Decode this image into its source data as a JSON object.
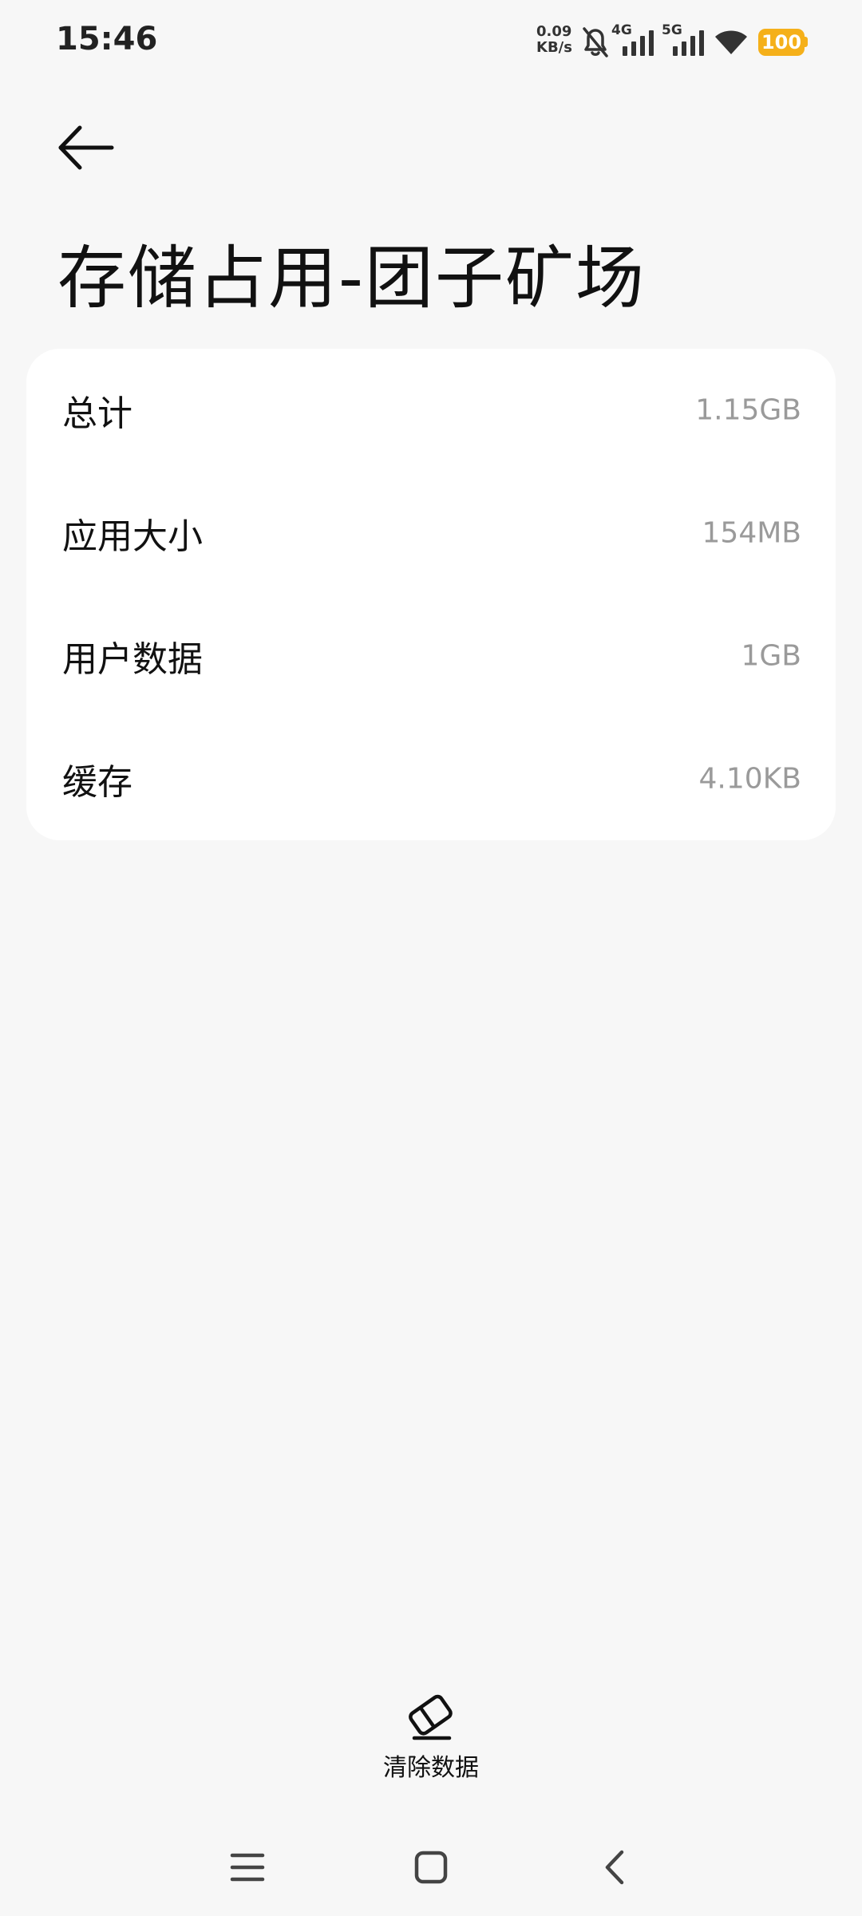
{
  "status_bar": {
    "time": "15:46",
    "net_speed_value": "0.09",
    "net_speed_unit": "KB/s",
    "sim1_label": "4G",
    "sim2_label": "5G",
    "battery_level": "100",
    "battery_color": "#f5b01a"
  },
  "header": {
    "title": "存储占用-团子矿场"
  },
  "storage": {
    "rows": [
      {
        "label": "总计",
        "value": "1.15GB"
      },
      {
        "label": "应用大小",
        "value": "154MB"
      },
      {
        "label": "用户数据",
        "value": "1GB"
      },
      {
        "label": "缓存",
        "value": "4.10KB"
      }
    ]
  },
  "actions": {
    "clear_data_label": "清除数据"
  },
  "icons": {
    "back": "arrow-left-icon",
    "clear": "eraser-icon",
    "nav_menu": "menu-icon",
    "nav_home": "square-home-icon",
    "nav_back": "chevron-left-icon"
  }
}
